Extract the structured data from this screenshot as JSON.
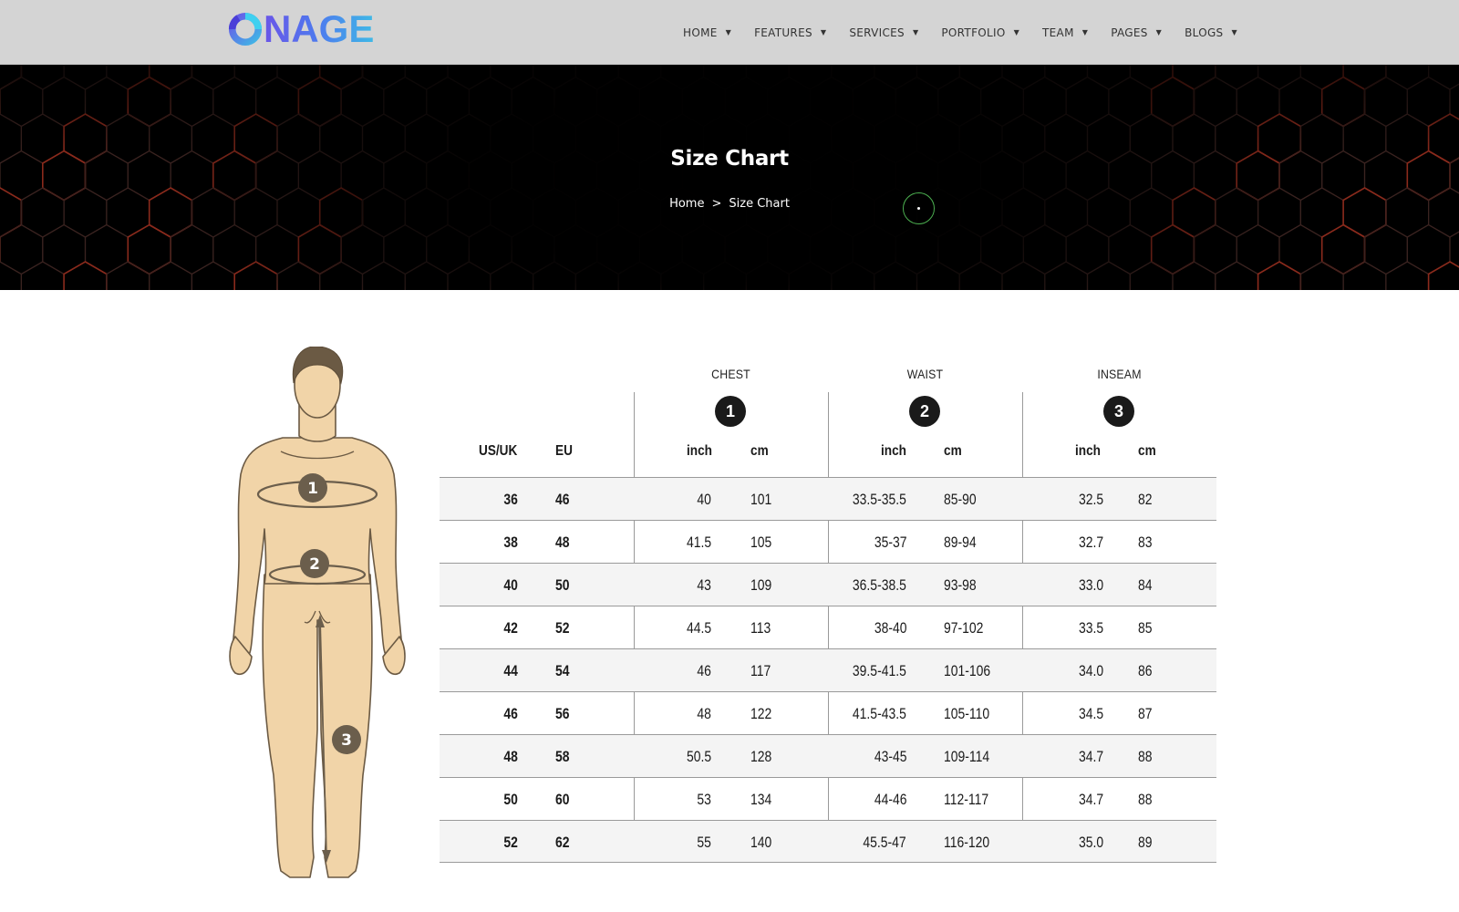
{
  "brand": {
    "logo_text": "NAGE",
    "logo_letter": "O"
  },
  "nav": [
    {
      "label": "HOME"
    },
    {
      "label": "FEATURES"
    },
    {
      "label": "SERVICES"
    },
    {
      "label": "PORTFOLIO"
    },
    {
      "label": "TEAM"
    },
    {
      "label": "PAGES"
    },
    {
      "label": "BLOGS"
    }
  ],
  "hero": {
    "title": "Size Chart",
    "breadcrumb": {
      "home": "Home",
      "separator": ">",
      "current": "Size Chart"
    }
  },
  "figure": {
    "markers": [
      "1",
      "2",
      "3"
    ]
  },
  "size_table": {
    "groups": [
      {
        "name": "CHEST",
        "badge": "1"
      },
      {
        "name": "WAIST",
        "badge": "2"
      },
      {
        "name": "INSEAM",
        "badge": "3"
      }
    ],
    "size_headers": {
      "us_uk": "US/UK",
      "eu": "EU"
    },
    "unit_headers": {
      "inch": "inch",
      "cm": "cm"
    },
    "rows": [
      {
        "us_uk": "36",
        "eu": "46",
        "chest_inch": "40",
        "chest_cm": "101",
        "waist_inch": "33.5-35.5",
        "waist_cm": "85-90",
        "inseam_inch": "32.5",
        "inseam_cm": "82"
      },
      {
        "us_uk": "38",
        "eu": "48",
        "chest_inch": "41.5",
        "chest_cm": "105",
        "waist_inch": "35-37",
        "waist_cm": "89-94",
        "inseam_inch": "32.7",
        "inseam_cm": "83"
      },
      {
        "us_uk": "40",
        "eu": "50",
        "chest_inch": "43",
        "chest_cm": "109",
        "waist_inch": "36.5-38.5",
        "waist_cm": "93-98",
        "inseam_inch": "33.0",
        "inseam_cm": "84"
      },
      {
        "us_uk": "42",
        "eu": "52",
        "chest_inch": "44.5",
        "chest_cm": "113",
        "waist_inch": "38-40",
        "waist_cm": "97-102",
        "inseam_inch": "33.5",
        "inseam_cm": "85"
      },
      {
        "us_uk": "44",
        "eu": "54",
        "chest_inch": "46",
        "chest_cm": "117",
        "waist_inch": "39.5-41.5",
        "waist_cm": "101-106",
        "inseam_inch": "34.0",
        "inseam_cm": "86"
      },
      {
        "us_uk": "46",
        "eu": "56",
        "chest_inch": "48",
        "chest_cm": "122",
        "waist_inch": "41.5-43.5",
        "waist_cm": "105-110",
        "inseam_inch": "34.5",
        "inseam_cm": "87"
      },
      {
        "us_uk": "48",
        "eu": "58",
        "chest_inch": "50.5",
        "chest_cm": "128",
        "waist_inch": "43-45",
        "waist_cm": "109-114",
        "inseam_inch": "34.7",
        "inseam_cm": "88"
      },
      {
        "us_uk": "50",
        "eu": "60",
        "chest_inch": "53",
        "chest_cm": "134",
        "waist_inch": "44-46",
        "waist_cm": "112-117",
        "inseam_inch": "34.7",
        "inseam_cm": "88"
      },
      {
        "us_uk": "52",
        "eu": "62",
        "chest_inch": "55",
        "chest_cm": "140",
        "waist_inch": "45.5-47",
        "waist_cm": "116-120",
        "inseam_inch": "35.0",
        "inseam_cm": "89"
      }
    ]
  },
  "colors": {
    "header_bg": "#d4d4d4",
    "hero_bg": "#000000",
    "hex_line": "#3a2320",
    "hex_accent": "#8a2a1c",
    "logo_gradient_start": "#6a55e8",
    "logo_gradient_end": "#3fb9e6",
    "badge": "#1a1a1a",
    "figure_skin": "#f1d4a8",
    "figure_hair": "#6b5a44",
    "figure_marker": "#6b5e4c",
    "cursor_ring": "#4caf50",
    "row_shade": "#f4f4f4"
  }
}
